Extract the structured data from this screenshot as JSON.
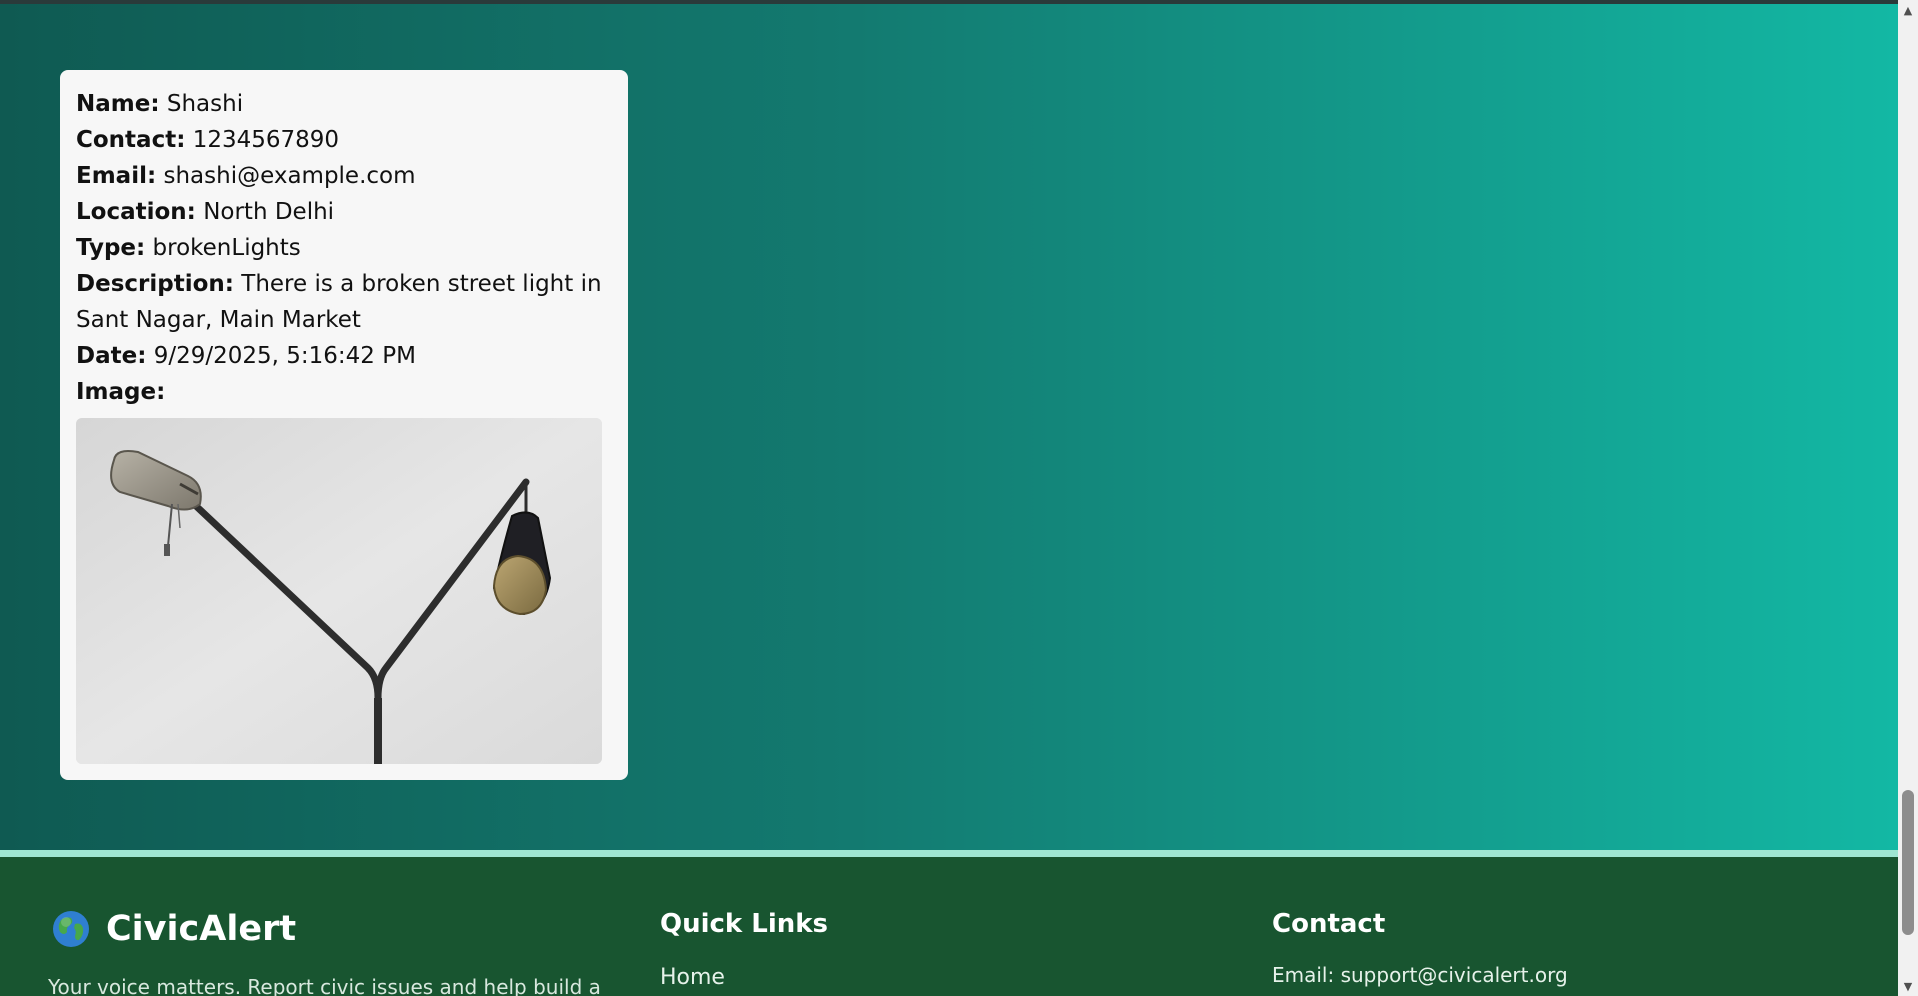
{
  "report": {
    "name_label": "Name:",
    "name_value": "Shashi",
    "contact_label": "Contact:",
    "contact_value": "1234567890",
    "email_label": "Email:",
    "email_value": "shashi@example.com",
    "location_label": "Location:",
    "location_value": "North Delhi",
    "type_label": "Type:",
    "type_value": "brokenLights",
    "description_label": "Description:",
    "description_value": "There is a broken street light in Sant Nagar, Main Market",
    "date_label": "Date:",
    "date_value": "9/29/2025, 5:16:42 PM",
    "image_label": "Image:",
    "image_icon": "broken-street-light-photo"
  },
  "footer": {
    "brand_icon": "globe-icon",
    "brand_name": "CivicAlert",
    "tagline": "Your voice matters. Report civic issues and help build a",
    "quick_links_title": "Quick Links",
    "quick_links": [
      "Home"
    ],
    "contact_title": "Contact",
    "contact_email": "Email: support@civicalert.org"
  },
  "colors": {
    "hero_gradient_start": "#0f5a52",
    "hero_gradient_end": "#13b8a4",
    "footer_bg": "#185530",
    "footer_accent_line": "#9fe6d2",
    "card_bg": "#f7f7f7"
  }
}
